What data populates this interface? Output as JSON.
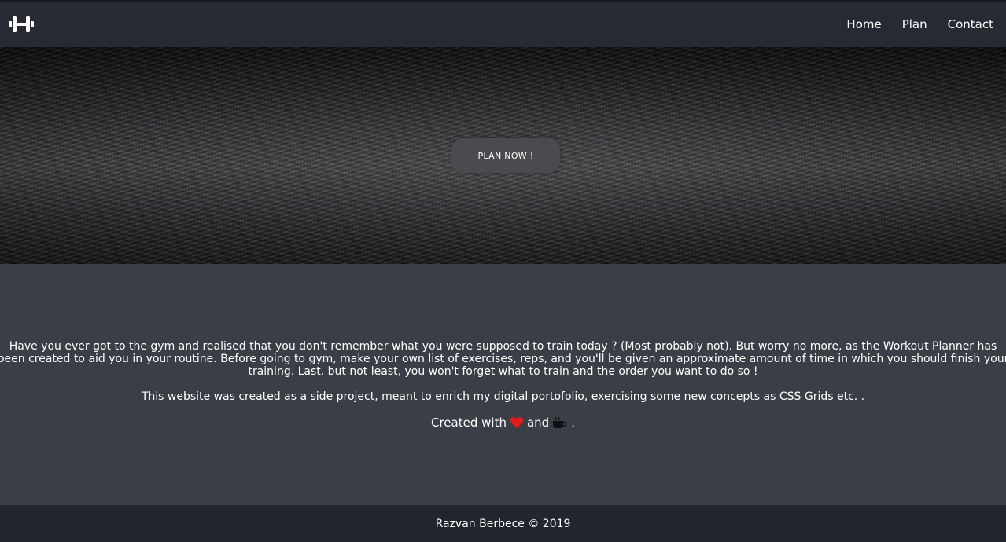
{
  "colors": {
    "navbar": "#272b31",
    "content_bg": "#3a3e45",
    "footer_bg": "#22262c",
    "button_bg": "#4a4b4e",
    "heart": "#e31b1b"
  },
  "navbar": {
    "logo_icon": "dumbbell-icon",
    "links": [
      {
        "label": "Home"
      },
      {
        "label": "Plan"
      },
      {
        "label": "Contact"
      }
    ]
  },
  "hero": {
    "button_label": "PLAN NOW !"
  },
  "about": {
    "paragraph_1": "Have you ever got to the gym and realised that you don't remember what you were supposed to train today ? (Most probably not). But worry no more, as the Workout Planner has been created to aid you in your routine. Before going to gym, make your own list of exercises, reps, and you'll be given an approximate amount of time in which you should finish your training. Last, but not least, you won't forget what to train and the order you want to do so !",
    "paragraph_2": "This website was created as a side project, meant to enrich my digital portofolio, exercising some new concepts as CSS Grids etc. .",
    "credits_prefix": "Created with",
    "credits_and": "and",
    "credits_suffix": ".",
    "heart_icon": "heart-icon",
    "coffee_icon": "coffee-icon"
  },
  "footer": {
    "text": "Razvan Berbece © 2019"
  }
}
